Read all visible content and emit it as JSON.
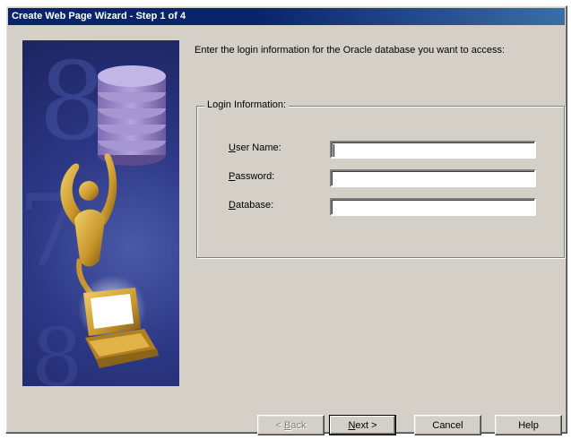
{
  "window": {
    "title": "Create Web Page Wizard - Step 1 of 4"
  },
  "instruction": "Enter the login information for the Oracle database you want to access:",
  "login_group": {
    "legend": "Login Information:",
    "fields": [
      {
        "label_mnemonic": "U",
        "label_rest": "ser Name:",
        "value": ""
      },
      {
        "label_mnemonic": "P",
        "label_rest": "assword:",
        "value": ""
      },
      {
        "label_mnemonic": "D",
        "label_rest": "atabase:",
        "value": ""
      }
    ]
  },
  "buttons": {
    "back": {
      "mnemonic": "B",
      "pre": "< ",
      "rest": "ack"
    },
    "next": {
      "mnemonic": "N",
      "rest": "ext >"
    },
    "cancel": "Cancel",
    "help": "Help"
  },
  "art": {
    "big_digits": [
      "8",
      "7",
      "8"
    ],
    "colors": {
      "background": "#2c3785",
      "disk": "#9a86c8",
      "figure": "#c8962c",
      "screen": "#ffffff"
    }
  }
}
